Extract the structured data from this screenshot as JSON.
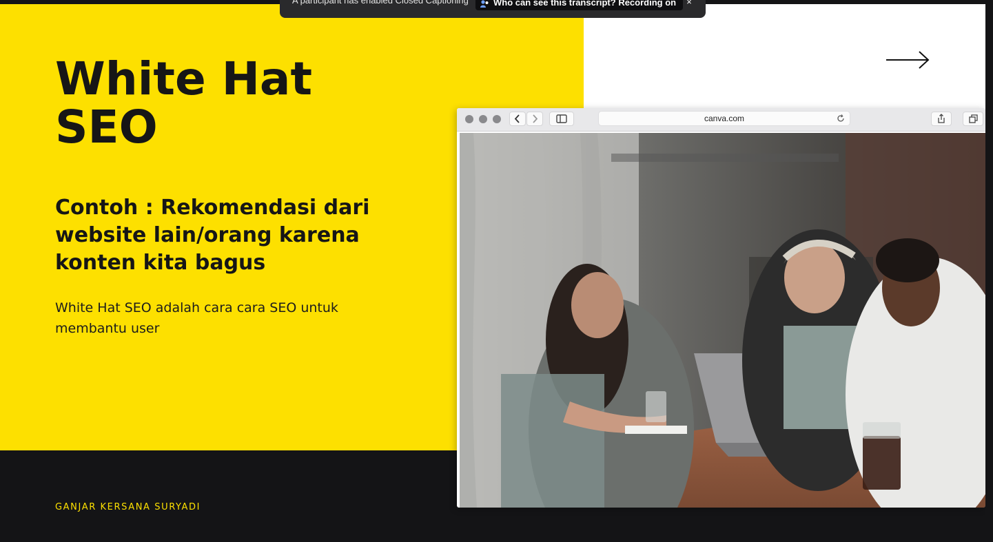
{
  "caption_banner": {
    "message": "A participant has enabled Closed Captioning",
    "link_label": "Who can see this transcript? Recording on",
    "close_label": "×"
  },
  "slide": {
    "title_line1": "White Hat",
    "title_line2": "SEO",
    "subtitle": "Contoh : Rekomendasi dari website lain/orang karena konten kita bagus",
    "body": "White Hat SEO adalah cara cara SEO untuk membantu user",
    "author": "GANJAR KERSANA SURYADI",
    "accent_color": "#fde000",
    "dark_color": "#141416"
  },
  "browser": {
    "url": "canva.com"
  }
}
